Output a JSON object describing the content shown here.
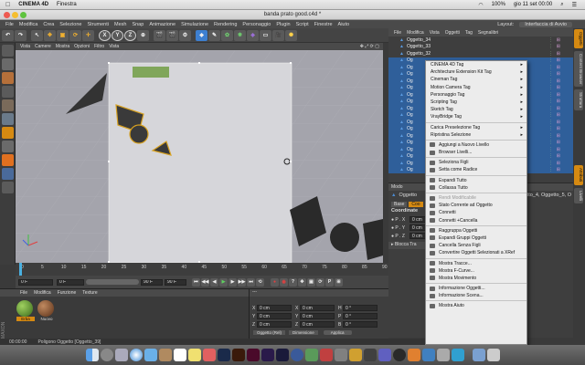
{
  "mac_menubar": {
    "app": "CINEMA 4D",
    "items": [
      "Finestra"
    ],
    "status": "100%",
    "datetime": "gio 11 set  00:00"
  },
  "window": {
    "title": "banda prato good.c4d *"
  },
  "c4d_menu": {
    "items": [
      "File",
      "Modifica",
      "Crea",
      "Selezione",
      "Strumenti",
      "Mesh",
      "Snap",
      "Animazione",
      "Simulazione",
      "Rendering",
      "Personaggio",
      "Plugin",
      "Script",
      "Finestre",
      "Aiuto"
    ],
    "layout_label": "Layout:",
    "layout_value": "Interfaccia di Avvio"
  },
  "toolbar": {
    "x": "X",
    "y": "Y",
    "z": "Z"
  },
  "viewport_menu": [
    "Vista",
    "Camere",
    "Mostra",
    "Opzioni",
    "Filtro",
    "Vista"
  ],
  "object_manager": {
    "menu": [
      "File",
      "Modifica",
      "Vista",
      "Oggetti",
      "Tag",
      "Segnalibri"
    ],
    "rows": [
      {
        "name": "Oggetto_34",
        "selected": false
      },
      {
        "name": "Oggetto_33",
        "selected": false
      },
      {
        "name": "Oggetto_32",
        "selected": false
      },
      {
        "name": "Og",
        "selected": true
      },
      {
        "name": "Og",
        "selected": true
      },
      {
        "name": "Og",
        "selected": true
      },
      {
        "name": "Og",
        "selected": true
      },
      {
        "name": "Og",
        "selected": true
      },
      {
        "name": "Og",
        "selected": true
      },
      {
        "name": "Og",
        "selected": true
      },
      {
        "name": "Og",
        "selected": true
      },
      {
        "name": "Og",
        "selected": true
      },
      {
        "name": "Og",
        "selected": true
      },
      {
        "name": "Og",
        "selected": true
      },
      {
        "name": "Og",
        "selected": true
      },
      {
        "name": "Og",
        "selected": true
      },
      {
        "name": "Og",
        "selected": true
      },
      {
        "name": "Og",
        "selected": true
      },
      {
        "name": "Og",
        "selected": true
      },
      {
        "name": "Og",
        "selected": true
      }
    ]
  },
  "context_menu": {
    "items": [
      {
        "label": "CINEMA 4D Tag",
        "submenu": true
      },
      {
        "label": "Architecture Extension Kit Tag",
        "submenu": true
      },
      {
        "label": "Cineman Tag",
        "submenu": true
      },
      {
        "label": "Motion Camera Tag",
        "submenu": true
      },
      {
        "label": "Personaggio Tag",
        "submenu": true
      },
      {
        "label": "Scripting Tag",
        "submenu": true
      },
      {
        "label": "Sketch Tag",
        "submenu": true
      },
      {
        "label": "VrayBridge Tag",
        "submenu": true
      },
      {
        "sep": true
      },
      {
        "label": "Carica Preselezione Tag",
        "submenu": true
      },
      {
        "label": "Ripristina Selezione",
        "submenu": true
      },
      {
        "sep": true
      },
      {
        "label": "Aggiungi a Nuovo Livello",
        "icon": true
      },
      {
        "label": "Browser Livelli...",
        "icon": true
      },
      {
        "sep": true
      },
      {
        "label": "Seleziona Figli",
        "icon": true
      },
      {
        "label": "Setta come Radice",
        "icon": true
      },
      {
        "sep": true
      },
      {
        "label": "Espandi Tutto",
        "icon": true
      },
      {
        "label": "Collassa Tutto",
        "icon": true
      },
      {
        "sep": true
      },
      {
        "label": "Rendi Modificabile",
        "icon": true,
        "disabled": true
      },
      {
        "label": "Stato Corrente ad Oggetto",
        "icon": true
      },
      {
        "label": "Connetti",
        "icon": true
      },
      {
        "label": "Connetti +Cancella",
        "icon": true
      },
      {
        "sep": true
      },
      {
        "label": "Raggruppa Oggetti",
        "icon": true
      },
      {
        "label": "Espandi Gruppi Oggetti",
        "icon": true
      },
      {
        "label": "Cancella Senza Figli",
        "icon": true
      },
      {
        "label": "Convertire Oggetti Selezionati a XRef",
        "icon": true
      },
      {
        "sep": true
      },
      {
        "label": "Mostra Tracce...",
        "icon": true
      },
      {
        "label": "Mostra F-Curve...",
        "icon": true
      },
      {
        "label": "Mostra Movimento",
        "icon": true
      },
      {
        "sep": true
      },
      {
        "label": "Informazione Oggetti...",
        "icon": true
      },
      {
        "label": "Informazione Scena...",
        "icon": true
      },
      {
        "sep": true
      },
      {
        "label": "Mostra Aiuto",
        "icon": true
      }
    ]
  },
  "attributes": {
    "mode_label": "Modo",
    "title": "Oggetto",
    "title_tail": "ggetto_4, Oggetto_5, O",
    "tab_base": "Base",
    "tab_coord": "Coo",
    "coord_header": "Coordinate",
    "rows": [
      {
        "label": "● P . X",
        "value": "0 cm"
      },
      {
        "label": "● P . Y",
        "value": "0 cm"
      },
      {
        "label": "● P . Z",
        "value": "0 cm"
      }
    ],
    "freeze_label": "▸ Blocca Tra"
  },
  "side_tabs": [
    "Oggetti",
    "Content Browser",
    "Struttura",
    "Attributi",
    "Livelli"
  ],
  "timeline": {
    "ticks": [
      "0",
      "5",
      "10",
      "15",
      "20",
      "25",
      "30",
      "35",
      "40",
      "45",
      "50",
      "55",
      "60",
      "65",
      "70",
      "75",
      "80",
      "85",
      "90"
    ],
    "current": "0 F",
    "start": "0 F",
    "end": "90 F",
    "end2": "90 F"
  },
  "material_manager": {
    "menu": [
      "File",
      "Modifica",
      "Funzione",
      "Texture"
    ],
    "materials": [
      "Erba",
      "Nuovo"
    ]
  },
  "coord_manager": {
    "header": "---",
    "rows": [
      {
        "axis": "X",
        "pos": "0 cm",
        "axis2": "X",
        "size": "0 cm",
        "axis3": "H",
        "rot": "0 °"
      },
      {
        "axis": "Y",
        "pos": "0 cm",
        "axis2": "Y",
        "size": "0 cm",
        "axis3": "P",
        "rot": "0 °"
      },
      {
        "axis": "Z",
        "pos": "0 cm",
        "axis2": "Z",
        "size": "0 cm",
        "axis3": "B",
        "rot": "0 °"
      }
    ],
    "mode1": "Oggetto (Rel)",
    "mode2": "Dimensione",
    "apply": "Applica"
  },
  "status": {
    "time": "00:00:00",
    "text": "Poligono Oggetto [Oggetto_39]"
  },
  "colors": {
    "accent": "#d68a12",
    "selection": "#2f5f9a",
    "menu_bg": "#ececec"
  }
}
